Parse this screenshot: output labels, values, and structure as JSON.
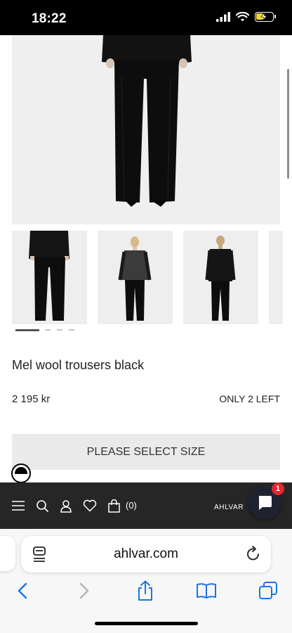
{
  "status_bar": {
    "time": "18:22",
    "battery_level": 0.45,
    "battery_color": "#f2d22e"
  },
  "product": {
    "title": "Mel wool trousers black",
    "price": "2 195 kr",
    "stock": "ONLY 2 LEFT",
    "size_button_label": "PLEASE SELECT SIZE",
    "gallery": {
      "thumbnails": [
        "front-view-jacket",
        "front-view-sheer-top",
        "back-view-sheer-top"
      ],
      "active_index": 0,
      "dot_count": 4
    }
  },
  "nav": {
    "cart_label": "(0)",
    "brand": "AHLVAR",
    "chat_badge": "1",
    "icons": [
      "menu-icon",
      "search-icon",
      "account-icon",
      "heart-icon",
      "bag-icon",
      "chat-icon"
    ]
  },
  "browser": {
    "url": "ahlvar.com"
  },
  "colors": {
    "nav_background": "#262626",
    "accent_link": "#1a73e8",
    "badge": "#e3262b",
    "page_background": "#ffffff"
  }
}
